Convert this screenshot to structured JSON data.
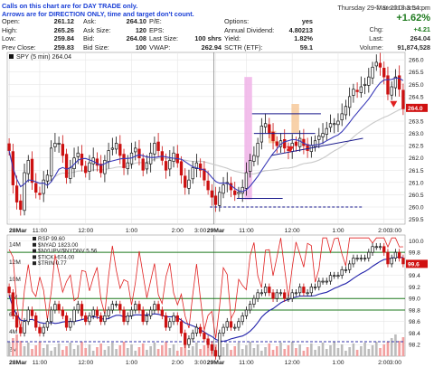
{
  "notes": {
    "line1": "Calls on this chart are for DAY TRADE only.",
    "line2": "Arrows are for DIRECTION ONLY, time and target don't count."
  },
  "header": {
    "datetime": "Thursday  29-Mar-2018  3:54 pm",
    "pct_change": "+1.62%",
    "chg_label": "Chg:",
    "chg": "+4.21",
    "last_label": "Last:",
    "last": "264.04",
    "volume_label": "Volume:",
    "volume": "91,874,528"
  },
  "quotes": {
    "col1": [
      {
        "label": "Open:",
        "value": "261.12"
      },
      {
        "label": "High:",
        "value": "265.26"
      },
      {
        "label": "Low:",
        "value": "259.84"
      },
      {
        "label": "Prev Close:",
        "value": "259.83"
      }
    ],
    "col2": [
      {
        "label": "Ask:",
        "value": "264.10"
      },
      {
        "label": "Ask Size:",
        "value": "120"
      },
      {
        "label": "Bid:",
        "value": "264.08"
      },
      {
        "label": "Bid Size:",
        "value": "100"
      }
    ],
    "col3": [
      {
        "label": "P/E:",
        "value": ""
      },
      {
        "label": "EPS:",
        "value": ""
      },
      {
        "label": "Last Size:",
        "value": "100 shrs"
      },
      {
        "label": "VWAP:",
        "value": "262.94"
      }
    ],
    "col4": [
      {
        "label": "Options:",
        "value": "yes"
      },
      {
        "label": "Annual Dividend:",
        "value": "4.80213"
      },
      {
        "label": "Yield:",
        "value": "1.82%"
      },
      {
        "label": "SCTR (ETF):",
        "value": "59.1"
      }
    ]
  },
  "watermark": "© StockCharts.com",
  "chart_data": [
    {
      "type": "candlestick",
      "legend": "SPY (5 min) 264.04",
      "x_tick_labels": [
        "28Mar",
        "11:00",
        "12:00",
        "1:00",
        "2:00",
        "3:00",
        "29Mar",
        "11:00",
        "12:00",
        "1:00",
        "2:00",
        "3:00"
      ],
      "y_ticks": [
        259.5,
        260.0,
        260.5,
        261.0,
        261.5,
        262.0,
        262.5,
        263.0,
        263.5,
        264.0,
        264.5,
        265.0,
        265.5,
        266.0
      ],
      "ylim": [
        259.3,
        266.3
      ],
      "last_value": 264.04,
      "last_value_label": "264.0",
      "closes": [
        262.3,
        260.9,
        260.2,
        259.9,
        261.4,
        261.9,
        261.0,
        260.6,
        260.5,
        261.1,
        261.3,
        262.4,
        262.6,
        262.6,
        262.1,
        261.2,
        261.6,
        262.0,
        262.2,
        261.7,
        261.4,
        261.8,
        262.0,
        261.7,
        261.4,
        261.9,
        262.3,
        262.4,
        262.6,
        262.1,
        261.6,
        261.8,
        262.2,
        262.4,
        262.0,
        261.5,
        261.8,
        262.2,
        262.6,
        262.3,
        261.9,
        261.5,
        261.9,
        262.2,
        261.8,
        261.3,
        260.8,
        261.1,
        261.6,
        261.8,
        261.5,
        261.1,
        260.7,
        260.4,
        260.1,
        260.6,
        260.9,
        261.0,
        260.7,
        260.5,
        260.6,
        260.8,
        261.4,
        261.9,
        262.1,
        262.6,
        263.3,
        263.4,
        263.0,
        262.7,
        262.5,
        262.7,
        262.4,
        262.3,
        262.6,
        262.5,
        262.8,
        262.5,
        262.3,
        262.5,
        262.7,
        262.9,
        263.0,
        263.2,
        263.4,
        263.4,
        263.5,
        263.8,
        264.1,
        264.5,
        264.8,
        264.7,
        264.9,
        265.0,
        265.3,
        265.7,
        265.9,
        265.7,
        265.3,
        264.6,
        264.9,
        265.3,
        264.8,
        264.0
      ],
      "opens_offset": 0.28,
      "annotations": [
        {
          "type": "box",
          "fill": "#f0b3e8",
          "x_from": 62.0,
          "x_to": 64.0,
          "y_from": 260.3,
          "y_to": 265.3
        },
        {
          "type": "box",
          "fill": "#f7c99a",
          "x_from": 68.3,
          "x_to": 70.3,
          "y_from": 262.6,
          "y_to": 263.1
        },
        {
          "type": "box",
          "fill": "#f7c99a",
          "x_from": 74.3,
          "x_to": 76.3,
          "y_from": 263.0,
          "y_to": 264.2
        },
        {
          "type": "hline",
          "color": "#1a1a8c",
          "x_from": 64.0,
          "x_to": 82.0,
          "y": 263.8
        },
        {
          "type": "hline",
          "color": "#1a1a8c",
          "x_from": 64.5,
          "x_to": 80.5,
          "y": 263.0
        },
        {
          "type": "hline",
          "color": "#1a1a8c",
          "x_from": 60.0,
          "x_to": 72.0,
          "y": 260.35
        },
        {
          "type": "hline",
          "color": "#1a1a8c",
          "x_from": 53.0,
          "x_to": 93.0,
          "y": 260.0,
          "dash": true
        },
        {
          "type": "trendline",
          "color": "#1a1a8c",
          "x_from": 69.0,
          "x_to": 93.0,
          "y_from": 262.1,
          "y_to": 262.8
        },
        {
          "type": "arrow",
          "direction": "down",
          "color": "#e02020",
          "x": 74.0,
          "y": 262.25
        },
        {
          "type": "arrow",
          "direction": "down",
          "color": "#e02020",
          "x": 101.0,
          "y": 264.1
        }
      ]
    },
    {
      "type": "line",
      "title": "RSP 99.60",
      "legend": [
        {
          "label": "RSP 99.60",
          "color": "#222222"
        },
        {
          "label": "$NYAD 1823.00",
          "color": "#222222"
        },
        {
          "label": "$NYUPV/$NYDNV 5.56",
          "color": "#222222"
        },
        {
          "label": "$TICK -674.00",
          "color": "#222222"
        },
        {
          "label": "$TRIN 0.77",
          "color": "#222222"
        }
      ],
      "left_ticks": [
        "2M",
        "4M",
        "6M",
        "8M",
        "10M",
        "12M",
        "14M"
      ],
      "right_ticks": [
        98.2,
        98.4,
        98.6,
        98.8,
        99.0,
        99.2,
        99.4,
        99.6,
        99.8,
        100.0
      ],
      "ylim": [
        98.0,
        100.1
      ],
      "last_value": 99.6,
      "x_tick_labels": [
        "28Mar",
        "11:00",
        "12:00",
        "1:00",
        "2:00",
        "3:00",
        "29Mar",
        "11:00",
        "12:00",
        "1:00",
        "2:00",
        "3:00"
      ],
      "rsp_closes": [
        99.1,
        98.7,
        98.5,
        98.4,
        98.6,
        98.8,
        98.7,
        98.5,
        98.4,
        98.5,
        98.6,
        98.8,
        98.9,
        98.8,
        98.7,
        98.5,
        98.6,
        98.8,
        98.9,
        98.7,
        98.6,
        98.7,
        98.8,
        98.7,
        98.6,
        98.7,
        98.8,
        98.9,
        98.9,
        98.8,
        98.6,
        98.7,
        98.8,
        98.9,
        98.8,
        98.6,
        98.7,
        98.8,
        98.9,
        98.8,
        98.7,
        98.5,
        98.6,
        98.7,
        98.6,
        98.4,
        98.2,
        98.3,
        98.4,
        98.5,
        98.4,
        98.3,
        98.2,
        98.1,
        98.0,
        98.4,
        98.5,
        98.6,
        98.5,
        98.5,
        98.6,
        98.7,
        98.8,
        98.9,
        99.0,
        99.1,
        99.1,
        99.2,
        99.1,
        99.0,
        99.1,
        99.1,
        99.0,
        99.0,
        99.1,
        99.1,
        99.2,
        99.1,
        99.1,
        99.2,
        99.2,
        99.3,
        99.3,
        99.3,
        99.4,
        99.4,
        99.4,
        99.5,
        99.5,
        99.6,
        99.7,
        99.7,
        99.7,
        99.7,
        99.8,
        99.9,
        99.9,
        99.9,
        99.8,
        99.6,
        99.7,
        99.8,
        99.7,
        99.6
      ],
      "nyad_line_color": "#e02020",
      "ratio_line_color": "#2222aa",
      "reference_lines": [
        {
          "color": "#1e7a1e",
          "value": 99.8
        },
        {
          "color": "#1e7a1e",
          "value": 99.0
        },
        {
          "color": "#1e7a1e",
          "value": 98.8
        },
        {
          "color": "#3333aa",
          "value": 98.25,
          "dash": true
        }
      ]
    }
  ],
  "colors": {
    "up_candle": "#111111",
    "down_candle": "#cc1111",
    "ma_line": "#3a3ab8",
    "ma_long": "#c9c9c9",
    "grid": "#e6e6e6",
    "accent_green": "#1e7a1e",
    "accent_red": "#d01010"
  }
}
